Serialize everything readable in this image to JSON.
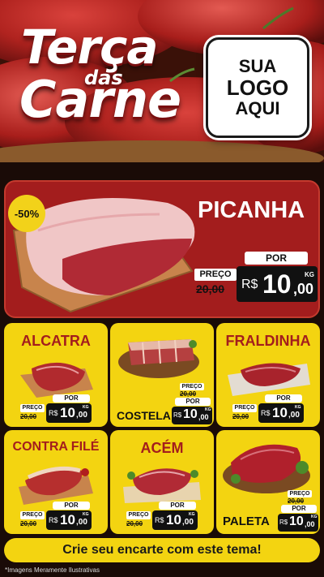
{
  "header": {
    "title_line1": "Terça",
    "title_das": "das",
    "title_line2": "Carne",
    "logo_line1": "SUA",
    "logo_line2": "LOGO",
    "logo_line3": "AQUI"
  },
  "featured": {
    "discount": "-50%",
    "name": "PICANHA",
    "old_label": "PREÇO",
    "old_price": "20,00",
    "new_label": "POR",
    "currency": "R$",
    "price_int": "10",
    "price_cents": ",00",
    "unit": "KG"
  },
  "products": [
    {
      "name": "ALCATRA",
      "old_label": "PREÇO",
      "old_price": "20,00",
      "new_label": "POR",
      "currency": "R$",
      "price_int": "10",
      "price_cents": ",00",
      "unit": "KG"
    },
    {
      "name": "COSTELA",
      "old_label": "PREÇO",
      "old_price": "20,00",
      "new_label": "POR",
      "currency": "R$",
      "price_int": "10",
      "price_cents": ",00",
      "unit": "KG"
    },
    {
      "name": "FRALDINHA",
      "old_label": "PREÇO",
      "old_price": "20,00",
      "new_label": "POR",
      "currency": "R$",
      "price_int": "10",
      "price_cents": ",00",
      "unit": "KG"
    },
    {
      "name": "CONTRA FILÉ",
      "old_label": "PREÇO",
      "old_price": "20,00",
      "new_label": "POR",
      "currency": "R$",
      "price_int": "10",
      "price_cents": ",00",
      "unit": "KG"
    },
    {
      "name": "ACÉM",
      "old_label": "PREÇO",
      "old_price": "20,00",
      "new_label": "POR",
      "currency": "R$",
      "price_int": "10",
      "price_cents": ",00",
      "unit": "KG"
    },
    {
      "name": "PALETA",
      "old_label": "PREÇO",
      "old_price": "20,00",
      "new_label": "POR",
      "currency": "R$",
      "price_int": "10",
      "price_cents": ",00",
      "unit": "KG"
    }
  ],
  "footer": {
    "cta": "Crie seu encarte com este tema!",
    "note": "*Imagens Meramente Ilustrativas"
  },
  "colors": {
    "red": "#a31d1d",
    "yellow": "#f3d411",
    "black": "#111111"
  }
}
